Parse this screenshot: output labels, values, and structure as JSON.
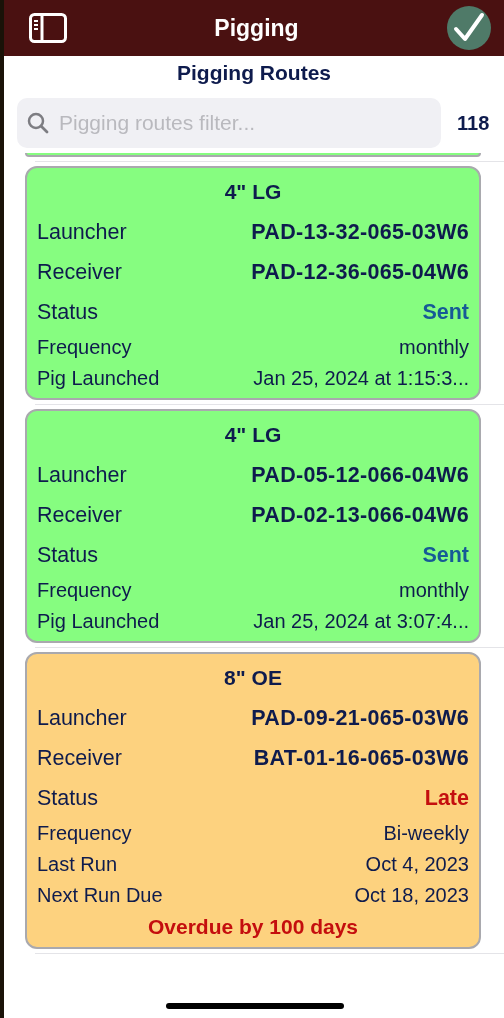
{
  "header": {
    "title": "Pigging"
  },
  "page_title": "Pigging Routes",
  "search": {
    "placeholder": "Pigging routes filter..."
  },
  "count": "118",
  "routes": [
    {
      "kind": "partial",
      "color": "#86fd80"
    },
    {
      "kind": "full",
      "color": "#86fd80",
      "title": "4\" LG",
      "fields": [
        {
          "kind": "big",
          "label": "Launcher",
          "value": "PAD-13-32-065-03W6"
        },
        {
          "kind": "big",
          "label": "Receiver",
          "value": "PAD-12-36-065-04W6"
        },
        {
          "kind": "status",
          "label": "Status",
          "value": "Sent",
          "color": "#165a96"
        },
        {
          "kind": "small",
          "label": "Frequency",
          "value": "monthly"
        },
        {
          "kind": "small",
          "label": "Pig Launched",
          "value": "Jan 25, 2024 at 1:15:3..."
        }
      ]
    },
    {
      "kind": "full",
      "color": "#86fd80",
      "title": "4\" LG",
      "fields": [
        {
          "kind": "big",
          "label": "Launcher",
          "value": "PAD-05-12-066-04W6"
        },
        {
          "kind": "big",
          "label": "Receiver",
          "value": "PAD-02-13-066-04W6"
        },
        {
          "kind": "status",
          "label": "Status",
          "value": "Sent",
          "color": "#165a96"
        },
        {
          "kind": "small",
          "label": "Frequency",
          "value": "monthly"
        },
        {
          "kind": "small",
          "label": "Pig Launched",
          "value": "Jan 25, 2024 at 3:07:4..."
        }
      ]
    },
    {
      "kind": "full",
      "color": "#fdd27f",
      "title": "8\" OE",
      "fields": [
        {
          "kind": "big",
          "label": "Launcher",
          "value": "PAD-09-21-065-03W6"
        },
        {
          "kind": "big",
          "label": "Receiver",
          "value": "BAT-01-16-065-03W6"
        },
        {
          "kind": "status",
          "label": "Status",
          "value": "Late",
          "color": "#c40e0e"
        },
        {
          "kind": "small",
          "label": "Frequency",
          "value": "Bi-weekly"
        },
        {
          "kind": "small",
          "label": "Last Run",
          "value": "Oct 4, 2023"
        },
        {
          "kind": "small",
          "label": "Next Run Due",
          "value": "Oct 18, 2023"
        }
      ],
      "notice": "Overdue by 100 days"
    }
  ]
}
